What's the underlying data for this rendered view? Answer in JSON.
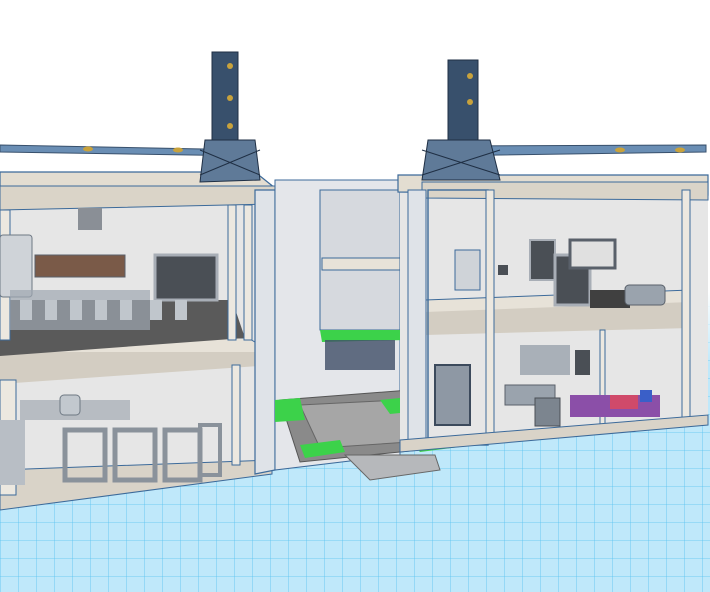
{
  "viewport": {
    "background": "#ffffff",
    "grid_color": "#56c2f0",
    "grid_fill": "#9fdcf7"
  },
  "colors": {
    "frame_blue": "#3c6a9a",
    "wall_beige": "#e9e5dd",
    "glass": "#dfe3e8",
    "floor_dark": "#5c5c5c",
    "grass_green": "#3cd24a",
    "crane_dark": "#38506c",
    "pipe_gold": "#c8a23c"
  },
  "scene": {
    "icons": [
      "tower-crane-icon",
      "building-model-icon",
      "stairs-icon",
      "door-icon",
      "furniture-icon"
    ]
  }
}
